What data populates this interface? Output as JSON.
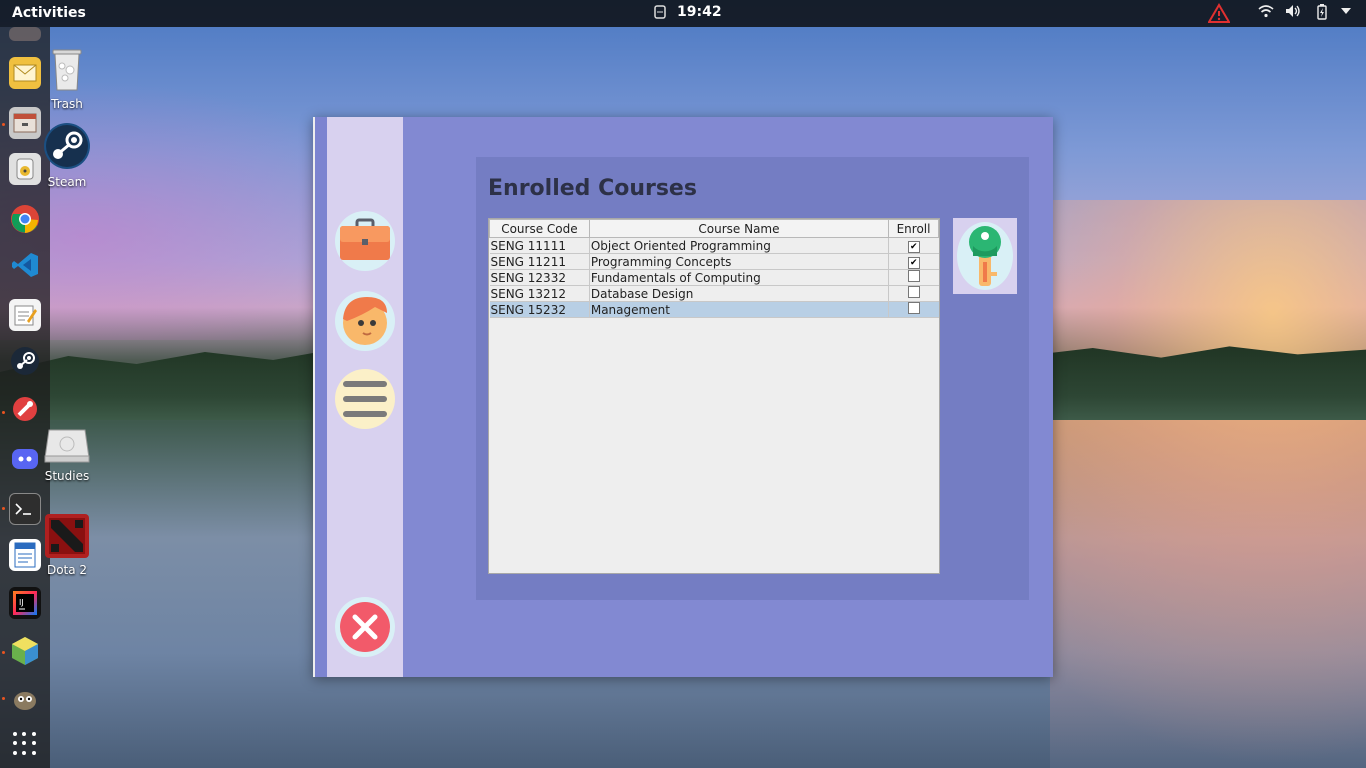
{
  "topbar": {
    "activities": "Activities",
    "clock": "19:42"
  },
  "desktop_icons": [
    {
      "label": "Trash"
    },
    {
      "label": "Steam"
    },
    {
      "label": "Studies"
    },
    {
      "label": "Dota 2"
    }
  ],
  "app": {
    "panel_title": "Enrolled Courses",
    "table": {
      "headers": [
        "Course Code",
        "Course Name",
        "Enroll"
      ],
      "rows": [
        {
          "code": "SENG 11111",
          "name": "Object Oriented Programming",
          "enroll": "✔"
        },
        {
          "code": "SENG 11211",
          "name": "Programming Concepts",
          "enroll": "✔"
        },
        {
          "code": "SENG 12332",
          "name": "Fundamentals of Computing",
          "enroll": ""
        },
        {
          "code": "SENG 13212",
          "name": "Database Design",
          "enroll": ""
        },
        {
          "code": "SENG 15232",
          "name": "Management",
          "enroll": ""
        }
      ]
    }
  }
}
